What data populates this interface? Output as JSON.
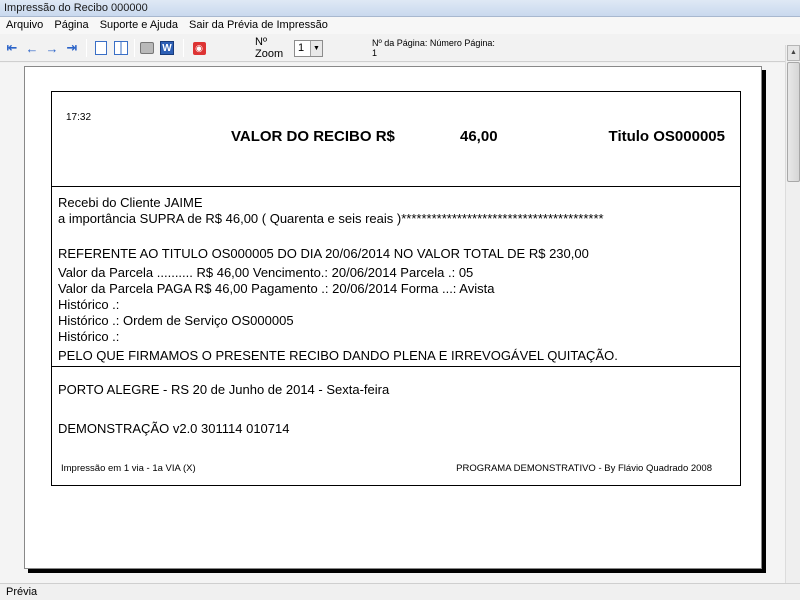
{
  "window": {
    "title": "Impressão do Recibo 000000"
  },
  "menu": [
    "Arquivo",
    "Página",
    "Suporte e Ajuda",
    "Sair da Prévia de Impressão"
  ],
  "toolbar": {
    "buttons": [
      {
        "name": "first-page-icon",
        "glyph": "⇤"
      },
      {
        "name": "prev-page-icon",
        "glyph": "←"
      },
      {
        "name": "next-page-icon",
        "glyph": "→"
      },
      {
        "name": "last-page-icon",
        "glyph": "⇥"
      }
    ],
    "zoom_label": "Nº Zoom",
    "zoom_value": "1",
    "page_info": "Nº da Página: Número Página: 1"
  },
  "receipt": {
    "time": "17:32",
    "header_title": "VALOR DO RECIBO R$",
    "header_value": "46,00",
    "header_titulo": "Titulo OS000005",
    "lines": [
      "Recebi do Cliente  JAIME",
      "a importância SUPRA de R$        46,00 ( Quarenta e seis reais )****************************************",
      "REFERENTE AO TITULO  OS000005    DO DIA 20/06/2014   NO VALOR TOTAL DE R$          230,00",
      "Valor da Parcela .......... R$          46,00   Vencimento.:  20/06/2014    Parcela .:  05",
      "Valor da Parcela PAGA R$          46,00   Pagamento .:  20/06/2014    Forma ...:  Avista",
      "Histórico .:",
      "Histórico .: Ordem de Serviço OS000005",
      "Histórico .:",
      "PELO QUE FIRMAMOS O PRESENTE RECIBO DANDO PLENA E IRREVOGÁVEL QUITAÇÃO."
    ],
    "city_date": "PORTO ALEGRE - RS 20 de Junho de 2014 - Sexta-feira",
    "demo": "DEMONSTRAÇÃO v2.0 301114 010714",
    "footer_left": "Impressão em 1 via  -  1a VIA (X)",
    "footer_right": "PROGRAMA DEMONSTRATIVO - By Flávio Quadrado 2008"
  },
  "status": {
    "text": "Prévia"
  }
}
